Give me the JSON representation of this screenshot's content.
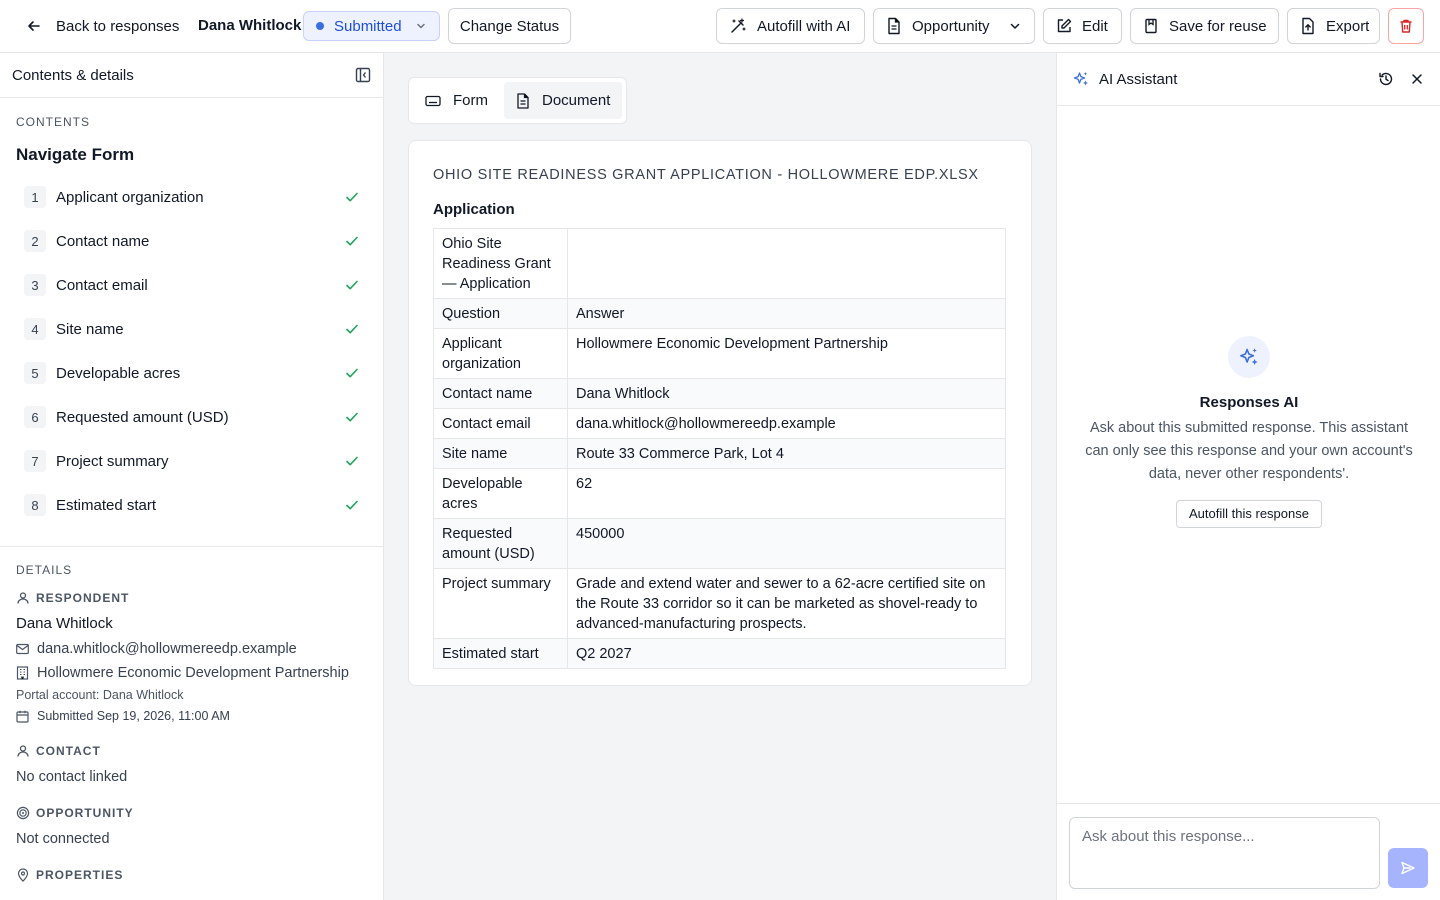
{
  "header": {
    "back_label": "Back to responses",
    "respondent_name": "Dana Whitlock",
    "status": "Submitted",
    "change_status_label": "Change Status",
    "autofill_label": "Autofill with AI",
    "opportunity_label": "Opportunity",
    "edit_label": "Edit",
    "save_reuse_label": "Save for reuse",
    "export_label": "Export"
  },
  "sidebar": {
    "title": "Contents & details",
    "contents_label": "CONTENTS",
    "nav_title": "Navigate Form",
    "items": [
      {
        "num": "1",
        "label": "Applicant organization"
      },
      {
        "num": "2",
        "label": "Contact name"
      },
      {
        "num": "3",
        "label": "Contact email"
      },
      {
        "num": "4",
        "label": "Site name"
      },
      {
        "num": "5",
        "label": "Developable acres"
      },
      {
        "num": "6",
        "label": "Requested amount (USD)"
      },
      {
        "num": "7",
        "label": "Project summary"
      },
      {
        "num": "8",
        "label": "Estimated start"
      }
    ],
    "details_label": "DETAILS",
    "respondent_label": "RESPONDENT",
    "respondent_name": "Dana Whitlock",
    "respondent_email": "dana.whitlock@hollowmereedp.example",
    "respondent_org": "Hollowmere Economic Development Partnership",
    "portal_account": "Portal account: Dana Whitlock",
    "submitted": "Submitted Sep 19, 2026, 11:00 AM",
    "contact_label": "CONTACT",
    "contact_value": "No contact linked",
    "opportunity_label": "OPPORTUNITY",
    "opportunity_value": "Not connected",
    "properties_label": "PROPERTIES"
  },
  "tabs": [
    {
      "label": "Form"
    },
    {
      "label": "Document"
    }
  ],
  "document": {
    "title": "OHIO SITE READINESS GRANT APPLICATION - HOLLOWMERE EDP.XLSX",
    "section": "Application",
    "rows": [
      [
        "Ohio Site Readiness Grant — Application",
        ""
      ],
      [
        "Question",
        "Answer"
      ],
      [
        "Applicant organization",
        "Hollowmere Economic Development Partnership"
      ],
      [
        "Contact name",
        "Dana Whitlock"
      ],
      [
        "Contact email",
        "dana.whitlock@hollowmereedp.example"
      ],
      [
        "Site name",
        "Route 33 Commerce Park, Lot 4"
      ],
      [
        "Developable acres",
        "62"
      ],
      [
        "Requested amount (USD)",
        "450000"
      ],
      [
        "Project summary",
        "Grade and extend water and sewer to a 62-acre certified site on the Route 33 corridor so it can be marketed as shovel-ready to advanced-manufacturing prospects."
      ],
      [
        "Estimated start",
        "Q2 2027"
      ]
    ]
  },
  "ai": {
    "title": "AI Assistant",
    "empty_title": "Responses AI",
    "empty_desc": "Ask about this submitted response. This assistant can only see this response and your own account's data, never other respondents'.",
    "autofill_label": "Autofill this response",
    "input_placeholder": "Ask about this response..."
  },
  "colors": {
    "accent": "#3b6fe0",
    "check": "#22a55a",
    "danger": "#dc2626",
    "send_button": "#a5b4fc"
  }
}
